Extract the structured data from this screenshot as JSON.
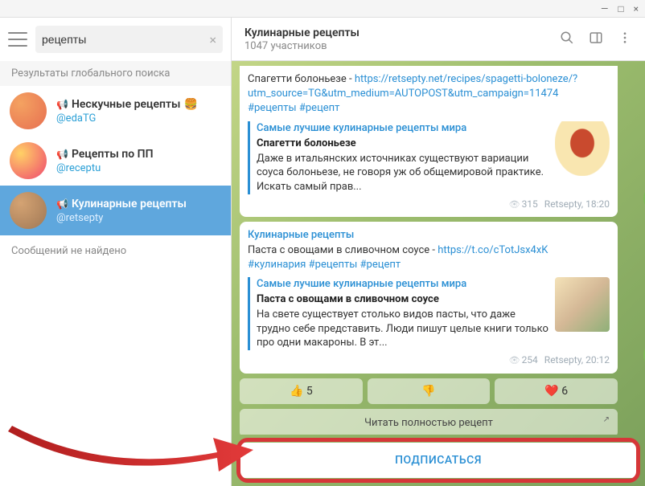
{
  "window": {
    "minimize": "—",
    "maximize": "□",
    "close": "×"
  },
  "search": {
    "value": "рецепты"
  },
  "sidebar": {
    "section_label": "Результаты глобального поиска",
    "results": [
      {
        "title": "Нескучные рецепты",
        "emoji": "🍔",
        "handle": "@edaTG"
      },
      {
        "title": "Рецепты по ПП",
        "emoji": "",
        "handle": "@receptu"
      },
      {
        "title": "Кулинарные рецепты",
        "emoji": "",
        "handle": "@retsepty"
      }
    ],
    "no_messages": "Сообщений не найдено"
  },
  "chat": {
    "title": "Кулинарные рецепты",
    "subtitle": "1047 участников"
  },
  "messages": [
    {
      "body_prefix": "Спагетти болоньезе - ",
      "link": "https://retsepty.net/recipes/spagetti-boloneze/?utm_source=TG&utm_medium=AUTOPOST&utm_campaign=11474",
      "hashtags": "#рецепты #рецепт",
      "preview": {
        "site": "Самые лучшие кулинарные рецепты мира",
        "title": "Спагетти болоньезе",
        "desc": "Даже в итальянских источниках существуют вариации соуса болоньезе, не говоря уж об общемировой практике. Искать самый прав..."
      },
      "views": "315",
      "author": "Retsepty",
      "time": "18:20"
    },
    {
      "channel": "Кулинарные рецепты",
      "body_prefix": "Паста с овощами в сливочном соусе - ",
      "link": "https://t.co/cTotJsx4xK",
      "hashtags": "#кулинария #рецепты #рецепт",
      "preview": {
        "site": "Самые лучшие кулинарные рецепты мира",
        "title": "Паста с овощами в сливочном соусе",
        "desc": "На свете существует столько видов пасты, что даже трудно себе представить. Люди пишут целые книги только про одни макароны. В эт..."
      },
      "views": "254",
      "author": "Retsepty",
      "time": "20:12"
    }
  ],
  "reactions": [
    {
      "emoji": "👍",
      "count": "5"
    },
    {
      "emoji": "👎",
      "count": ""
    },
    {
      "emoji": "❤️",
      "count": "6"
    }
  ],
  "read_more": "Читать полностью рецепт",
  "subscribe": "ПОДПИСАТЬСЯ"
}
